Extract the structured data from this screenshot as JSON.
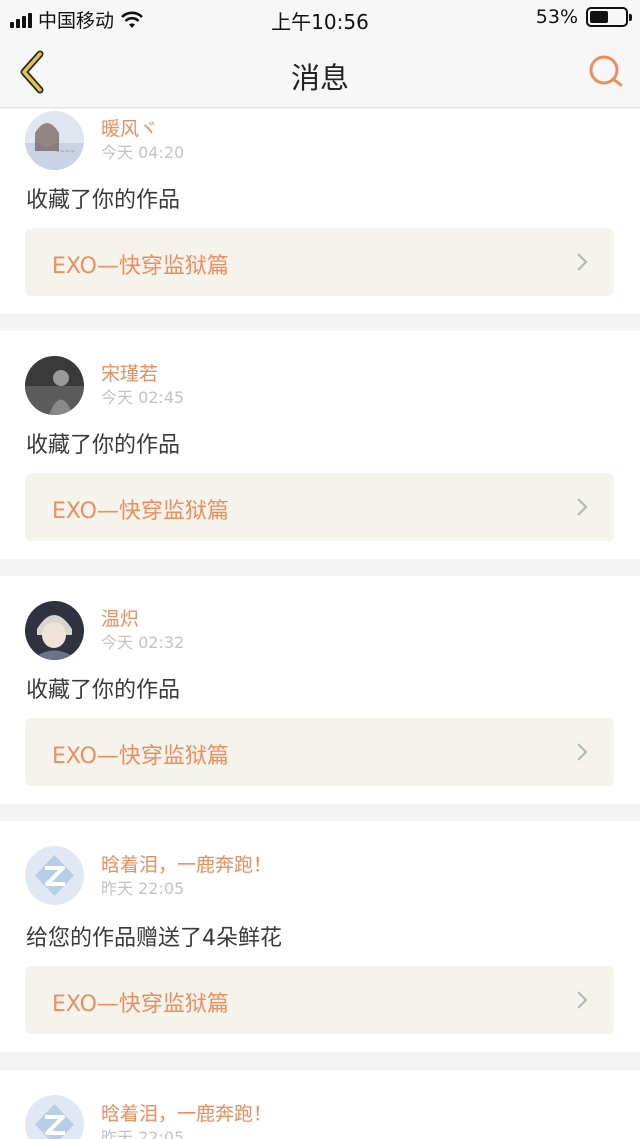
{
  "status_bar": {
    "carrier": "中国移动",
    "time": "上午10:56",
    "battery_percent": "53%",
    "battery_level": 0.53
  },
  "nav": {
    "title": "消息",
    "back_icon": "chevron-left-icon",
    "search_icon": "search-icon"
  },
  "colors": {
    "accent": "#ef8e5d",
    "back_icon": "#e3c64a",
    "card_link_bg": "#f4f4ed"
  },
  "messages": [
    {
      "username": "暖风ヾ",
      "time": "今天 04:20",
      "action": "收藏了你的作品",
      "work_title": "EXO—快穿监狱篇",
      "avatar": "avatar-girl"
    },
    {
      "username": "宋瑾若",
      "time": "今天 02:45",
      "action": "收藏了你的作品",
      "work_title": "EXO—快穿监狱篇",
      "avatar": "avatar-dark"
    },
    {
      "username": "温炽",
      "time": "今天 02:32",
      "action": "收藏了你的作品",
      "work_title": "EXO—快穿监狱篇",
      "avatar": "avatar-boy"
    },
    {
      "username": "晗着泪，一鹿奔跑！",
      "time": "昨天 22:05",
      "action": "给您的作品赠送了4朵鲜花",
      "work_title": "EXO—快穿监狱篇",
      "avatar": "avatar-default"
    },
    {
      "username": "晗着泪，一鹿奔跑！",
      "time": "昨天 22:05",
      "action": "",
      "work_title": "",
      "avatar": "avatar-default"
    }
  ]
}
